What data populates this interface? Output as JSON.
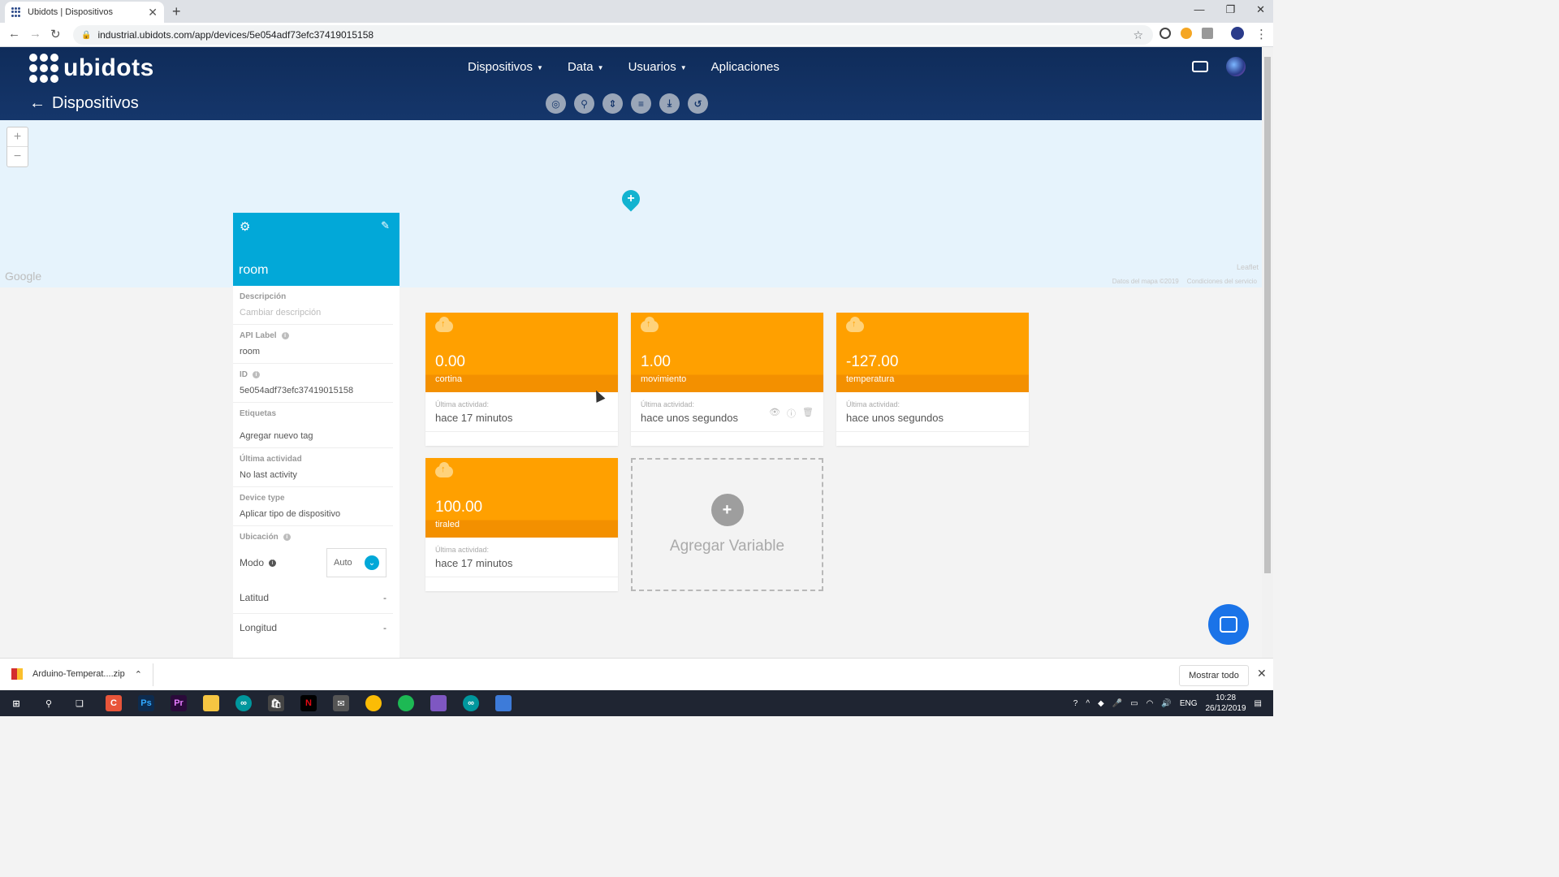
{
  "browser": {
    "tab_title": "Ubidots | Dispositivos",
    "url": "industrial.ubidots.com/app/devices/5e054adf73efc37419015158"
  },
  "header": {
    "logo_text": "ubidots",
    "nav": [
      {
        "label": "Dispositivos",
        "caret": true
      },
      {
        "label": "Data",
        "caret": true
      },
      {
        "label": "Usuarios",
        "caret": true
      },
      {
        "label": "Aplicaciones",
        "caret": false
      }
    ],
    "back_label": "Dispositivos"
  },
  "map": {
    "zoom_in": "+",
    "zoom_out": "−",
    "google_label": "Google",
    "leaflet_label": "Leaflet",
    "map_data": "Datos del mapa ©2019",
    "terms": "Condiciones del servicio"
  },
  "device": {
    "name": "room",
    "fields": {
      "descripcion_label": "Descripción",
      "descripcion_placeholder": "Cambiar descripción",
      "api_label_label": "API Label",
      "api_label_value": "room",
      "id_label": "ID",
      "id_value": "5e054adf73efc37419015158",
      "etiquetas_label": "Etiquetas",
      "etiquetas_value": "Agregar nuevo tag",
      "ultima_label": "Última actividad",
      "ultima_value": "No last activity",
      "device_type_label": "Device type",
      "device_type_value": "Aplicar tipo de dispositivo",
      "ubicacion_label": "Ubicación",
      "modo_label": "Modo",
      "modo_value": "Auto",
      "latitud_label": "Latitud",
      "latitud_value": "-",
      "longitud_label": "Longitud",
      "longitud_value": "-"
    }
  },
  "variables": [
    {
      "value": "0.00",
      "name": "cortina",
      "activity_label": "Última actividad:",
      "activity": "hace 17 minutos"
    },
    {
      "value": "1.00",
      "name": "movimiento",
      "activity_label": "Última actividad:",
      "activity": "hace unos segundos"
    },
    {
      "value": "-127.00",
      "name": "temperatura",
      "activity_label": "Última actividad:",
      "activity": "hace unos segundos"
    },
    {
      "value": "100.00",
      "name": "tiraled",
      "activity_label": "Última actividad:",
      "activity": "hace 17 minutos"
    }
  ],
  "add_variable": {
    "plus": "+",
    "label": "Agregar Variable"
  },
  "downloads": {
    "file": "Arduino-Temperat....zip",
    "show_all": "Mostrar todo"
  },
  "taskbar": {
    "lang": "ENG",
    "time": "10:28",
    "date": "26/12/2019"
  },
  "colors": {
    "header": "#15366b",
    "device": "#02a8d8",
    "variable": "#ffa000"
  }
}
